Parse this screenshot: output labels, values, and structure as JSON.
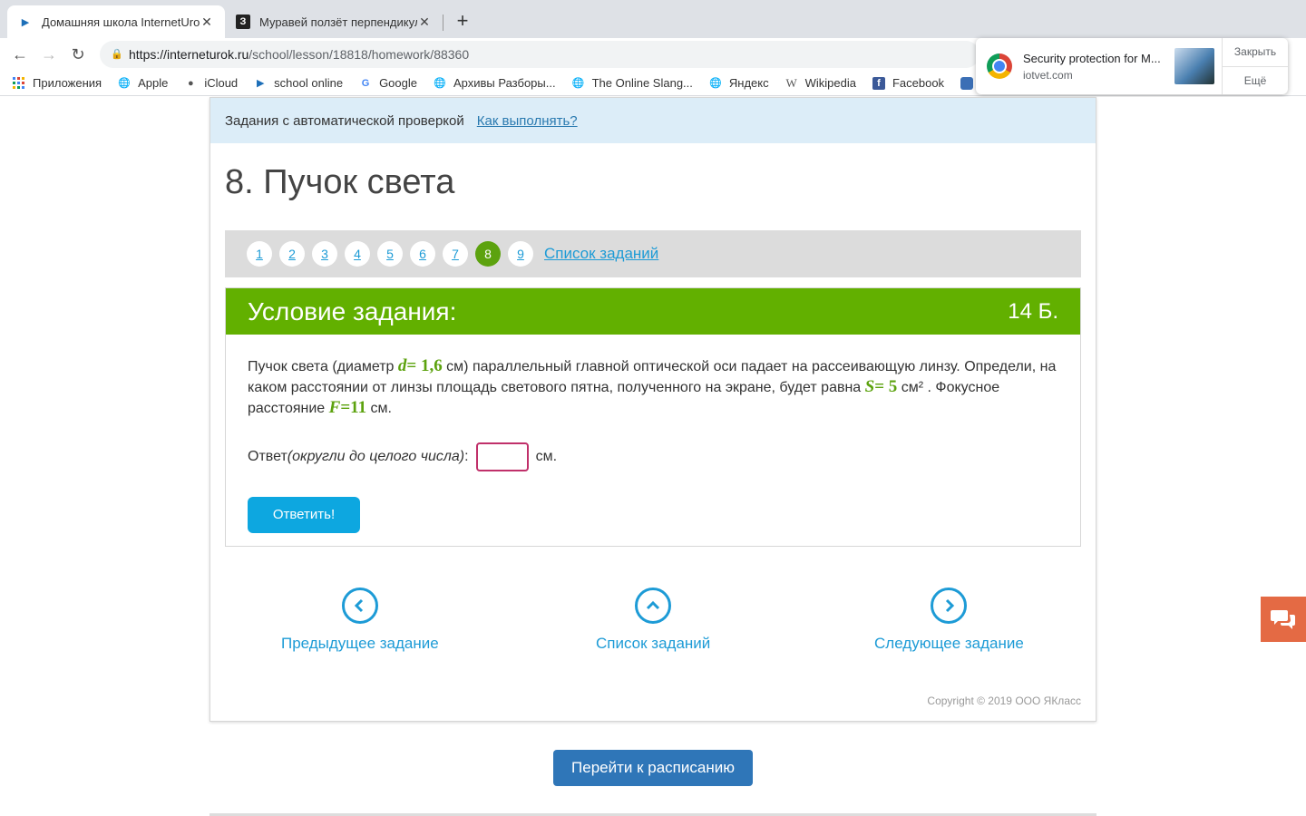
{
  "browser": {
    "tabs": [
      {
        "title": "Домашняя школа InternetUrok",
        "favicon": "play-icon"
      },
      {
        "title": "Муравей ползёт перпендикул",
        "favicon": "znanija-icon",
        "favicon_text": "З"
      }
    ],
    "url_host": "https://interneturok.ru",
    "url_path": "/school/lesson/18818/homework/88360",
    "bookmarks": [
      {
        "label": "Приложения",
        "icon": "apps-grid-icon"
      },
      {
        "label": "Apple",
        "icon": "globe-icon"
      },
      {
        "label": "iCloud",
        "icon": "apple-icon"
      },
      {
        "label": "school online",
        "icon": "play-icon"
      },
      {
        "label": "Google",
        "icon": "google-icon"
      },
      {
        "label": "Архивы Разборы...",
        "icon": "globe-icon"
      },
      {
        "label": "The Online Slang...",
        "icon": "globe-icon"
      },
      {
        "label": "Яндекс",
        "icon": "globe-icon"
      },
      {
        "label": "Wikipedia",
        "icon": "wikipedia-icon"
      },
      {
        "label": "Facebook",
        "icon": "facebook-icon"
      }
    ]
  },
  "notification": {
    "title": "Security protection for M...",
    "source": "iotvet.com",
    "close_label": "Закрыть",
    "more_label": "Ещё"
  },
  "page": {
    "info_text": "Задания с автоматической проверкой",
    "info_link": "Как выполнять?",
    "task_title": "8. Пучок света",
    "pager": [
      "1",
      "2",
      "3",
      "4",
      "5",
      "6",
      "7",
      "8",
      "9"
    ],
    "current_page": "8",
    "task_list_link": "Список заданий",
    "condition": {
      "header": "Условие задания:",
      "points": "14 Б.",
      "text_1": "Пучок света (диаметр ",
      "math_d": "d",
      "math_d_val": "= 1,6",
      "text_2": " см) параллельный главной оптической оси падает на рассеивающую линзу. Определи, на каком расстоянии от линзы площадь светового пятна, полученного на экране, будет равна ",
      "math_s": "S",
      "math_s_val": "= 5",
      "text_3": " см² . Фокусное расстояние ",
      "math_f": "F",
      "math_f_val": "=11",
      "text_4": " см.",
      "answer_label": "Ответ ",
      "answer_hint": "(округли до целого числа)",
      "answer_colon": ":",
      "answer_value": "",
      "answer_unit": "см.",
      "submit_label": "Ответить!"
    },
    "nav": {
      "prev": "Предыдущее задание",
      "list": "Список заданий",
      "next": "Следующее задание"
    },
    "copyright": "Copyright © 2019 ООО ЯКласс",
    "schedule_button": "Перейти к расписанию"
  },
  "colors": {
    "green": "#62b000",
    "blue_link": "#1d9bd6",
    "button_blue": "#0da7e0",
    "schedule_blue": "#2f76b8",
    "chat_orange": "#e46a44"
  }
}
